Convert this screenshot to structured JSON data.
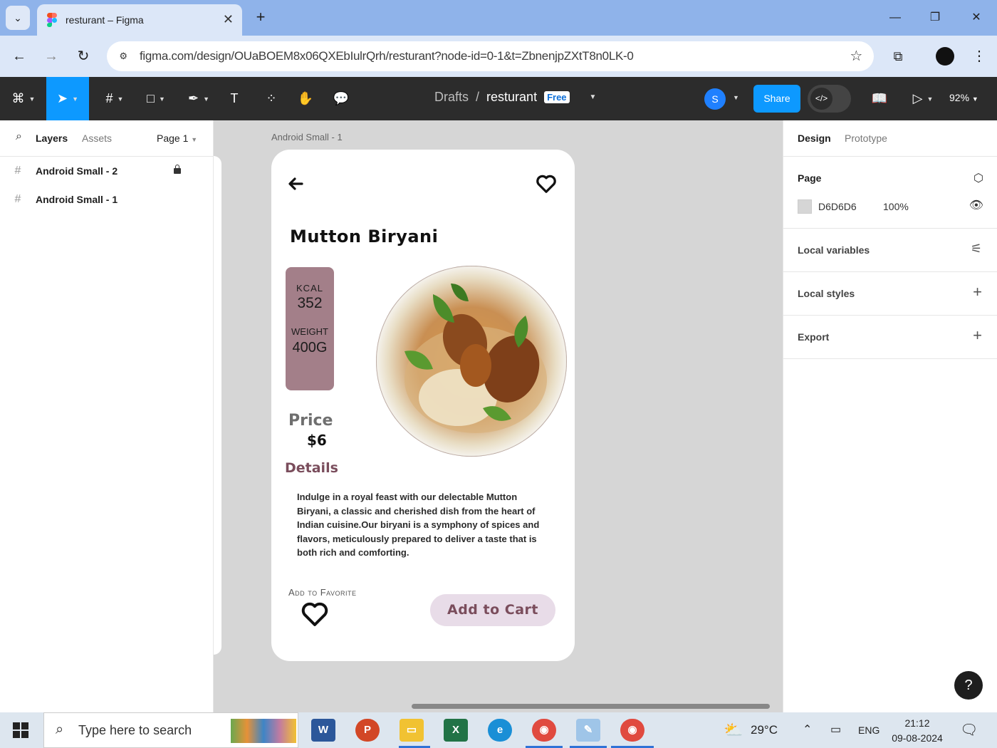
{
  "browser": {
    "tab_title": "resturant – Figma",
    "url": "figma.com/design/OUaBOEM8x06QXEbIulrQrh/resturant?node-id=0-1&t=ZbnenjpZXtT8n0LK-0"
  },
  "toolbar": {
    "breadcrumb_drafts": "Drafts",
    "breadcrumb_sep": "/",
    "file_name": "resturant",
    "plan_badge": "Free",
    "avatar_initial": "S",
    "share_label": "Share",
    "zoom": "92%"
  },
  "left_panel": {
    "tabs": [
      "Layers",
      "Assets"
    ],
    "page_selector": "Page 1",
    "layers": [
      {
        "name": "Android Small - 2",
        "locked": true
      },
      {
        "name": "Android Small - 1",
        "locked": false
      }
    ]
  },
  "right_panel": {
    "tabs": [
      "Design",
      "Prototype"
    ],
    "page_section_title": "Page",
    "page_color_hex": "D6D6D6",
    "page_opacity": "100%",
    "sections": [
      "Local variables",
      "Local styles",
      "Export"
    ]
  },
  "canvas": {
    "frame_label": "Android Small - 1",
    "app": {
      "dish_name": "Mutton Biryani",
      "kcal_label": "KCAL",
      "kcal_value": "352",
      "weight_label": "WEIGHT",
      "weight_value": "400G",
      "price_label": "Price",
      "price_value": "$6",
      "details_heading": "Details",
      "details_text": "Indulge in a royal feast with our delectable Mutton Biryani, a classic and cherished dish from the heart of Indian cuisine.Our biryani is a symphony of spices and flavors, meticulously prepared to deliver a taste that is both rich and comforting.",
      "favorite_label": "Add to Favorite",
      "cart_button": "Add to Cart"
    }
  },
  "taskbar": {
    "search_placeholder": "Type here to search",
    "temperature": "29°C",
    "language": "ENG",
    "time": "21:12",
    "date": "09-08-2024"
  },
  "colors": {
    "accent": "#0d99ff",
    "stats_card": "#a37f89",
    "cart_button_bg": "#e8dce8",
    "app_accent_text": "#7a4d5c"
  }
}
